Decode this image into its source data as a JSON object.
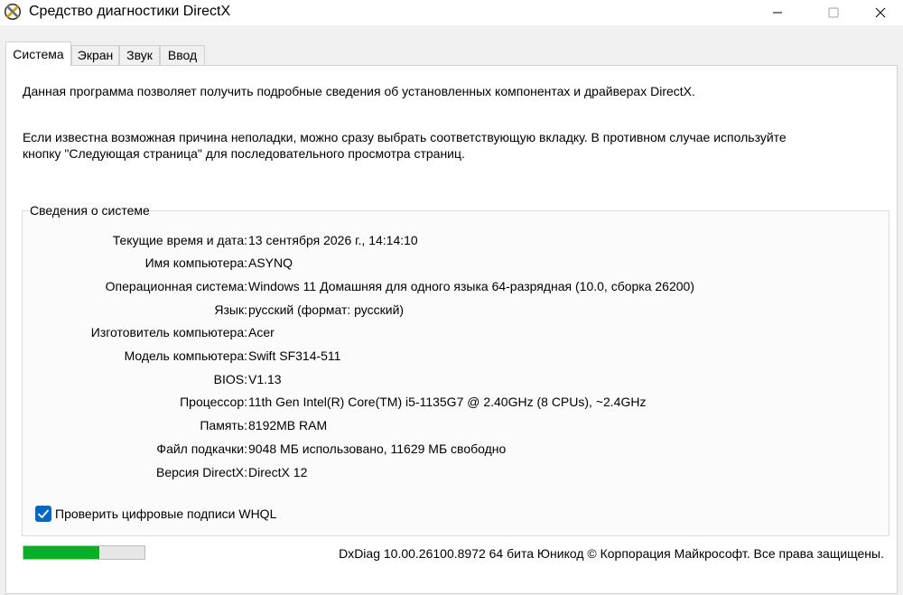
{
  "window": {
    "title": "Средство диагностики DirectX",
    "icon": "directx-x-icon"
  },
  "tabs": [
    {
      "label": "Система",
      "active": true
    },
    {
      "label": "Экран",
      "active": false
    },
    {
      "label": "Звук",
      "active": false
    },
    {
      "label": "Ввод",
      "active": false
    }
  ],
  "intro": {
    "line1": "Данная программа позволяет получить подробные сведения об установленных компонентах и драйверах DirectX.",
    "line2": "Если известна возможная причина неполадки, можно сразу выбрать соответствующую вкладку. В противном случае используйте",
    "line3": "кнопку \"Следующая страница\" для последовательного просмотра страниц."
  },
  "system_info": {
    "title": "Сведения о системе",
    "rows": [
      {
        "label": "Текущие время и дата:",
        "value": "13 сентября 2026 г., 14:14:10"
      },
      {
        "label": "Имя компьютера:",
        "value": "ASYNQ"
      },
      {
        "label": "Операционная система:",
        "value": "Windows 11 Домашняя для одного языка 64-разрядная (10.0, сборка 26200)"
      },
      {
        "label": "Язык:",
        "value": "русский (формат: русский)"
      },
      {
        "label": "Изготовитель компьютера:",
        "value": "Acer"
      },
      {
        "label": "Модель компьютера:",
        "value": "Swift SF314-511"
      },
      {
        "label": "BIOS:",
        "value": "V1.13"
      },
      {
        "label": "Процессор:",
        "value": "11th Gen Intel(R) Core(TM) i5-1135G7 @ 2.40GHz (8 CPUs), ~2.4GHz"
      },
      {
        "label": "Память:",
        "value": "8192MB RAM"
      },
      {
        "label": "Файл подкачки:",
        "value": "9048 МБ использовано, 11629 МБ свободно"
      },
      {
        "label": "Версия DirectX:",
        "value": "DirectX 12"
      }
    ]
  },
  "whql": {
    "label": "Проверить цифровые подписи WHQL",
    "checked": true
  },
  "progress": {
    "fraction": 0.63
  },
  "footer": "DxDiag 10.00.26100.8972 64 бита Юникод © Корпорация Майкрософт. Все права защищены.",
  "colors": {
    "accent": "#0067c0",
    "progress": "#06b025"
  }
}
